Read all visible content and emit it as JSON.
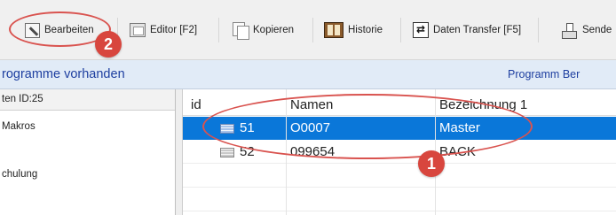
{
  "toolbar": {
    "items": [
      {
        "label": "Bearbeiten",
        "icon": "edit-icon"
      },
      {
        "label": "Editor [F2]",
        "icon": "editor-icon"
      },
      {
        "label": "Kopieren",
        "icon": "copy-icon"
      },
      {
        "label": "Historie",
        "icon": "history-icon"
      },
      {
        "label": "Daten Transfer [F5]",
        "icon": "transfer-icon"
      },
      {
        "label": "Sende",
        "icon": "send-icon"
      }
    ]
  },
  "infobar": {
    "left": "rogramme vorhanden",
    "right": "Programm Ber"
  },
  "leftpanel": {
    "header": "ten ID:25",
    "items": [
      "Makros",
      "chulung"
    ]
  },
  "grid": {
    "columns": [
      "id",
      "Namen",
      "Bezeichnung 1"
    ],
    "rows": [
      {
        "id": "51",
        "name": "O0007",
        "desc": "Master",
        "selected": true
      },
      {
        "id": "52",
        "name": "099654",
        "desc": "BACK",
        "selected": false
      }
    ]
  },
  "annotations": {
    "badge1": "1",
    "badge2": "2",
    "color": "#d8463e"
  },
  "colors": {
    "selection": "#0a77d9",
    "infobar_text": "#1e3fa0",
    "infobar_bg": "#e1ebf7"
  }
}
